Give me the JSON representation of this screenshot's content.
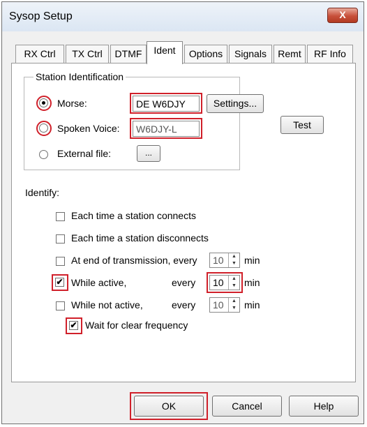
{
  "window": {
    "title": "Sysop Setup",
    "close_label": "X"
  },
  "tabs": [
    "RX Ctrl",
    "TX Ctrl",
    "DTMF",
    "Ident",
    "Options",
    "Signals",
    "Remt",
    "RF Info"
  ],
  "station_identification": {
    "group_label": "Station Identification",
    "morse_label": "Morse:",
    "morse_value": "DE W6DJY",
    "settings_label": "Settings...",
    "spoken_label": "Spoken Voice:",
    "spoken_value": "W6DJY-L",
    "external_label": "External file:",
    "browse_label": "...",
    "selected": "morse"
  },
  "test_label": "Test",
  "identify": {
    "label": "Identify:",
    "each_connect": "Each time a station connects",
    "each_disconnect": "Each time a station disconnects",
    "end_transmission": "At end of transmission, every",
    "while_active": "While active,",
    "while_not_active": "While not active,",
    "every": "every",
    "min": "min",
    "end_transmission_value": "10",
    "while_active_value": "10",
    "while_not_active_value": "10",
    "wait_clear": "Wait for clear frequency",
    "checked": {
      "each_connect": false,
      "each_disconnect": false,
      "end_transmission": false,
      "while_active": true,
      "while_not_active": false,
      "wait_clear": true
    }
  },
  "buttons": {
    "ok": "OK",
    "cancel": "Cancel",
    "help": "Help"
  },
  "colors": {
    "highlight": "#d0202a"
  }
}
